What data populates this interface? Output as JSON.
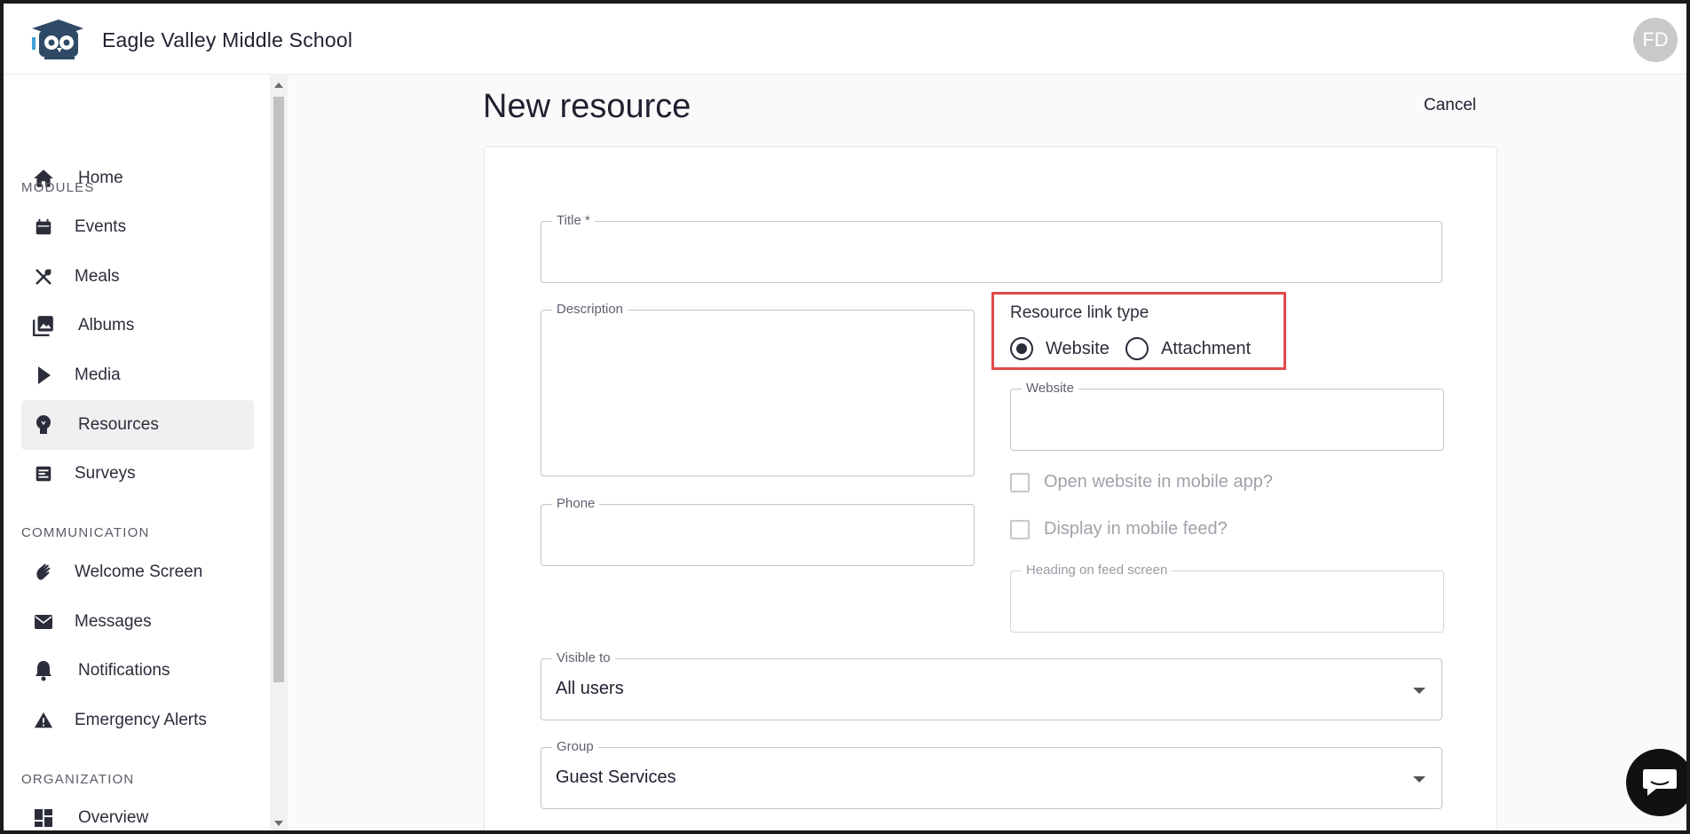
{
  "header": {
    "school_name": "Eagle Valley Middle School",
    "avatar_initials": "FD"
  },
  "sidebar": {
    "home": "Home",
    "sections": {
      "modules": "MODULES",
      "communication": "COMMUNICATION",
      "organization": "ORGANIZATION"
    },
    "modules": [
      {
        "label": "Events",
        "icon": "calendar-icon"
      },
      {
        "label": "Meals",
        "icon": "utensils-icon"
      },
      {
        "label": "Albums",
        "icon": "photo-album-icon"
      },
      {
        "label": "Media",
        "icon": "play-icon"
      },
      {
        "label": "Resources",
        "icon": "lightbulb-icon",
        "active": true
      },
      {
        "label": "Surveys",
        "icon": "survey-icon"
      }
    ],
    "communication": [
      {
        "label": "Welcome Screen",
        "icon": "wave-hand-icon"
      },
      {
        "label": "Messages",
        "icon": "envelope-icon"
      },
      {
        "label": "Notifications",
        "icon": "bell-icon"
      },
      {
        "label": "Emergency Alerts",
        "icon": "warning-icon"
      }
    ],
    "organization": [
      {
        "label": "Overview",
        "icon": "dashboard-icon"
      }
    ]
  },
  "main": {
    "title": "New resource",
    "cancel_label": "Cancel",
    "form": {
      "title_label": "Title *",
      "title_value": "",
      "description_label": "Description",
      "description_value": "",
      "phone_label": "Phone",
      "phone_value": "",
      "link_type_label": "Resource link type",
      "link_type_options": [
        "Website",
        "Attachment"
      ],
      "link_type_selected": "Website",
      "website_label": "Website",
      "website_value": "",
      "open_in_app_label": "Open website in mobile app?",
      "display_feed_label": "Display in mobile feed?",
      "feed_heading_label": "Heading on feed screen",
      "visible_to_label": "Visible to",
      "visible_to_value": "All users",
      "group_label": "Group",
      "group_value": "Guest Services"
    }
  },
  "colors": {
    "highlight_border": "#e24a4a",
    "active_nav_bg": "#f0f0f0",
    "text_primary": "#1f2130"
  }
}
